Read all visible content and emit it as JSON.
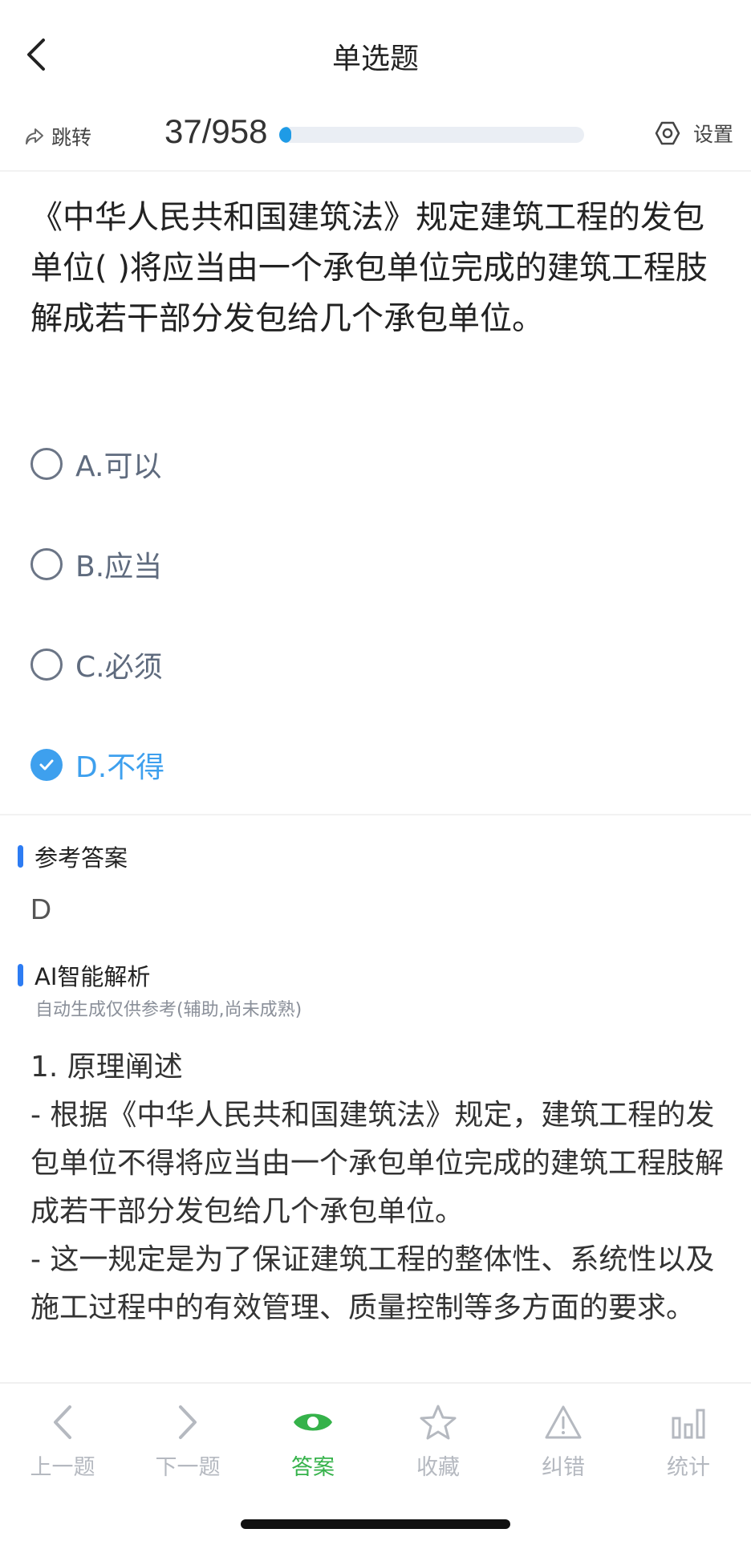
{
  "nav": {
    "title": "单选题"
  },
  "progress": {
    "jump_label": "跳转",
    "count_text": "37/958",
    "current": 37,
    "total": 958,
    "settings_label": "设置"
  },
  "question": {
    "text": "《中华人民共和国建筑法》规定建筑工程的发包单位( )将应当由一个承包单位完成的建筑工程肢解成若干部分发包给几个承包单位。"
  },
  "options": [
    {
      "label": "A.可以",
      "selected": false
    },
    {
      "label": "B.应当",
      "selected": false
    },
    {
      "label": "C.必须",
      "selected": false
    },
    {
      "label": "D.不得",
      "selected": true
    }
  ],
  "reference": {
    "heading": "参考答案",
    "answer": "D"
  },
  "ai": {
    "heading": "AI智能解析",
    "subtitle": "自动生成仅供参考(辅助,尚未成熟)",
    "paragraphs": [
      "1. 原理阐述",
      "- 根据《中华人民共和国建筑法》规定，建筑工程的发包单位不得将应当由一个承包单位完成的建筑工程肢解成若干部分发包给几个承包单位。",
      "- 这一规定是为了保证建筑工程的整体性、系统性以及施工过程中的有效管理、质量控制等多方面的要求。"
    ]
  },
  "tabbar": {
    "items": [
      {
        "label": "上一题",
        "icon": "chevron-left-icon"
      },
      {
        "label": "下一题",
        "icon": "chevron-right-icon"
      },
      {
        "label": "答案",
        "icon": "eye-icon",
        "active": true
      },
      {
        "label": "收藏",
        "icon": "star-icon"
      },
      {
        "label": "纠错",
        "icon": "warning-icon"
      },
      {
        "label": "统计",
        "icon": "bar-chart-icon"
      }
    ]
  },
  "colors": {
    "accent_blue": "#3ea0ee",
    "progress_blue": "#1f9be6",
    "section_mark": "#2d7cf3",
    "tab_active": "#35b24a",
    "tab_inactive": "#b5b9c0"
  }
}
